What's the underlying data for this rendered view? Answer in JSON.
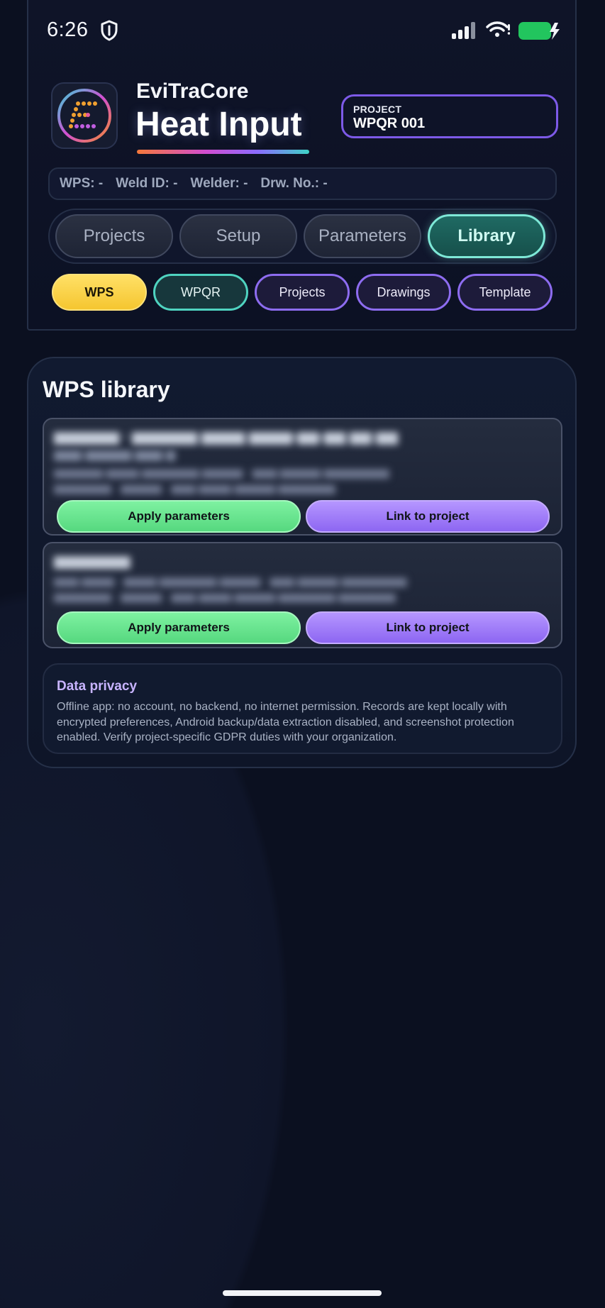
{
  "status_bar": {
    "time": "6:26",
    "icons": [
      "shield-icon",
      "signal-icon",
      "wifi-icon",
      "battery-charging-icon"
    ],
    "battery_color": "#22c55e"
  },
  "header": {
    "app_name": "EviTraCore",
    "title": "Heat Input",
    "project": {
      "label": "PROJECT",
      "value": "WPQR 001"
    },
    "meta": {
      "wps": "WPS: -",
      "weld_id": "Weld ID: -",
      "welder": "Welder: -",
      "drawing": "Drw. No.: -"
    },
    "tabs": [
      {
        "label": "Projects",
        "active": false
      },
      {
        "label": "Setup",
        "active": false
      },
      {
        "label": "Parameters",
        "active": false
      },
      {
        "label": "Library",
        "active": true
      }
    ],
    "chips": [
      {
        "label": "WPS",
        "active": true
      },
      {
        "label": "WPQR",
        "active": false
      },
      {
        "label": "Projects",
        "active": false
      },
      {
        "label": "Drawings",
        "active": false
      },
      {
        "label": "Template",
        "active": false
      }
    ]
  },
  "library": {
    "title": "WPS library",
    "entries": [
      {
        "apply_label": "Apply parameters",
        "link_label": "Link to project"
      },
      {
        "apply_label": "Apply parameters",
        "link_label": "Link to project"
      }
    ],
    "privacy": {
      "title": "Data privacy",
      "text": "Offline app: no account, no backend, no internet permission. Records are kept locally with encrypted preferences, Android backup/data extraction disabled, and screenshot protection enabled. Verify project-specific GDPR duties with your organization."
    }
  },
  "colors": {
    "accent_teal": "#7ee8d7",
    "accent_violet": "#8d6cf0",
    "accent_yellow": "#f5c630",
    "button_green": "#56d87f",
    "button_purple": "#8d66f2"
  }
}
